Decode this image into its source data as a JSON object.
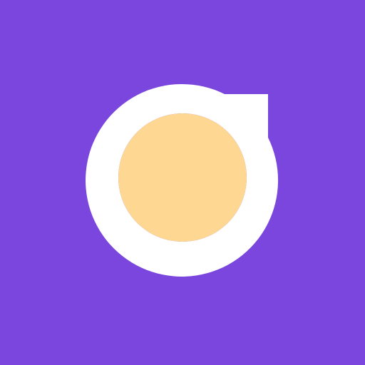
{
  "colors": {
    "background": "#7b46dd",
    "ring": "#ffffff",
    "core": "#fed892"
  },
  "icon": {
    "name": "app-logo-icon"
  }
}
